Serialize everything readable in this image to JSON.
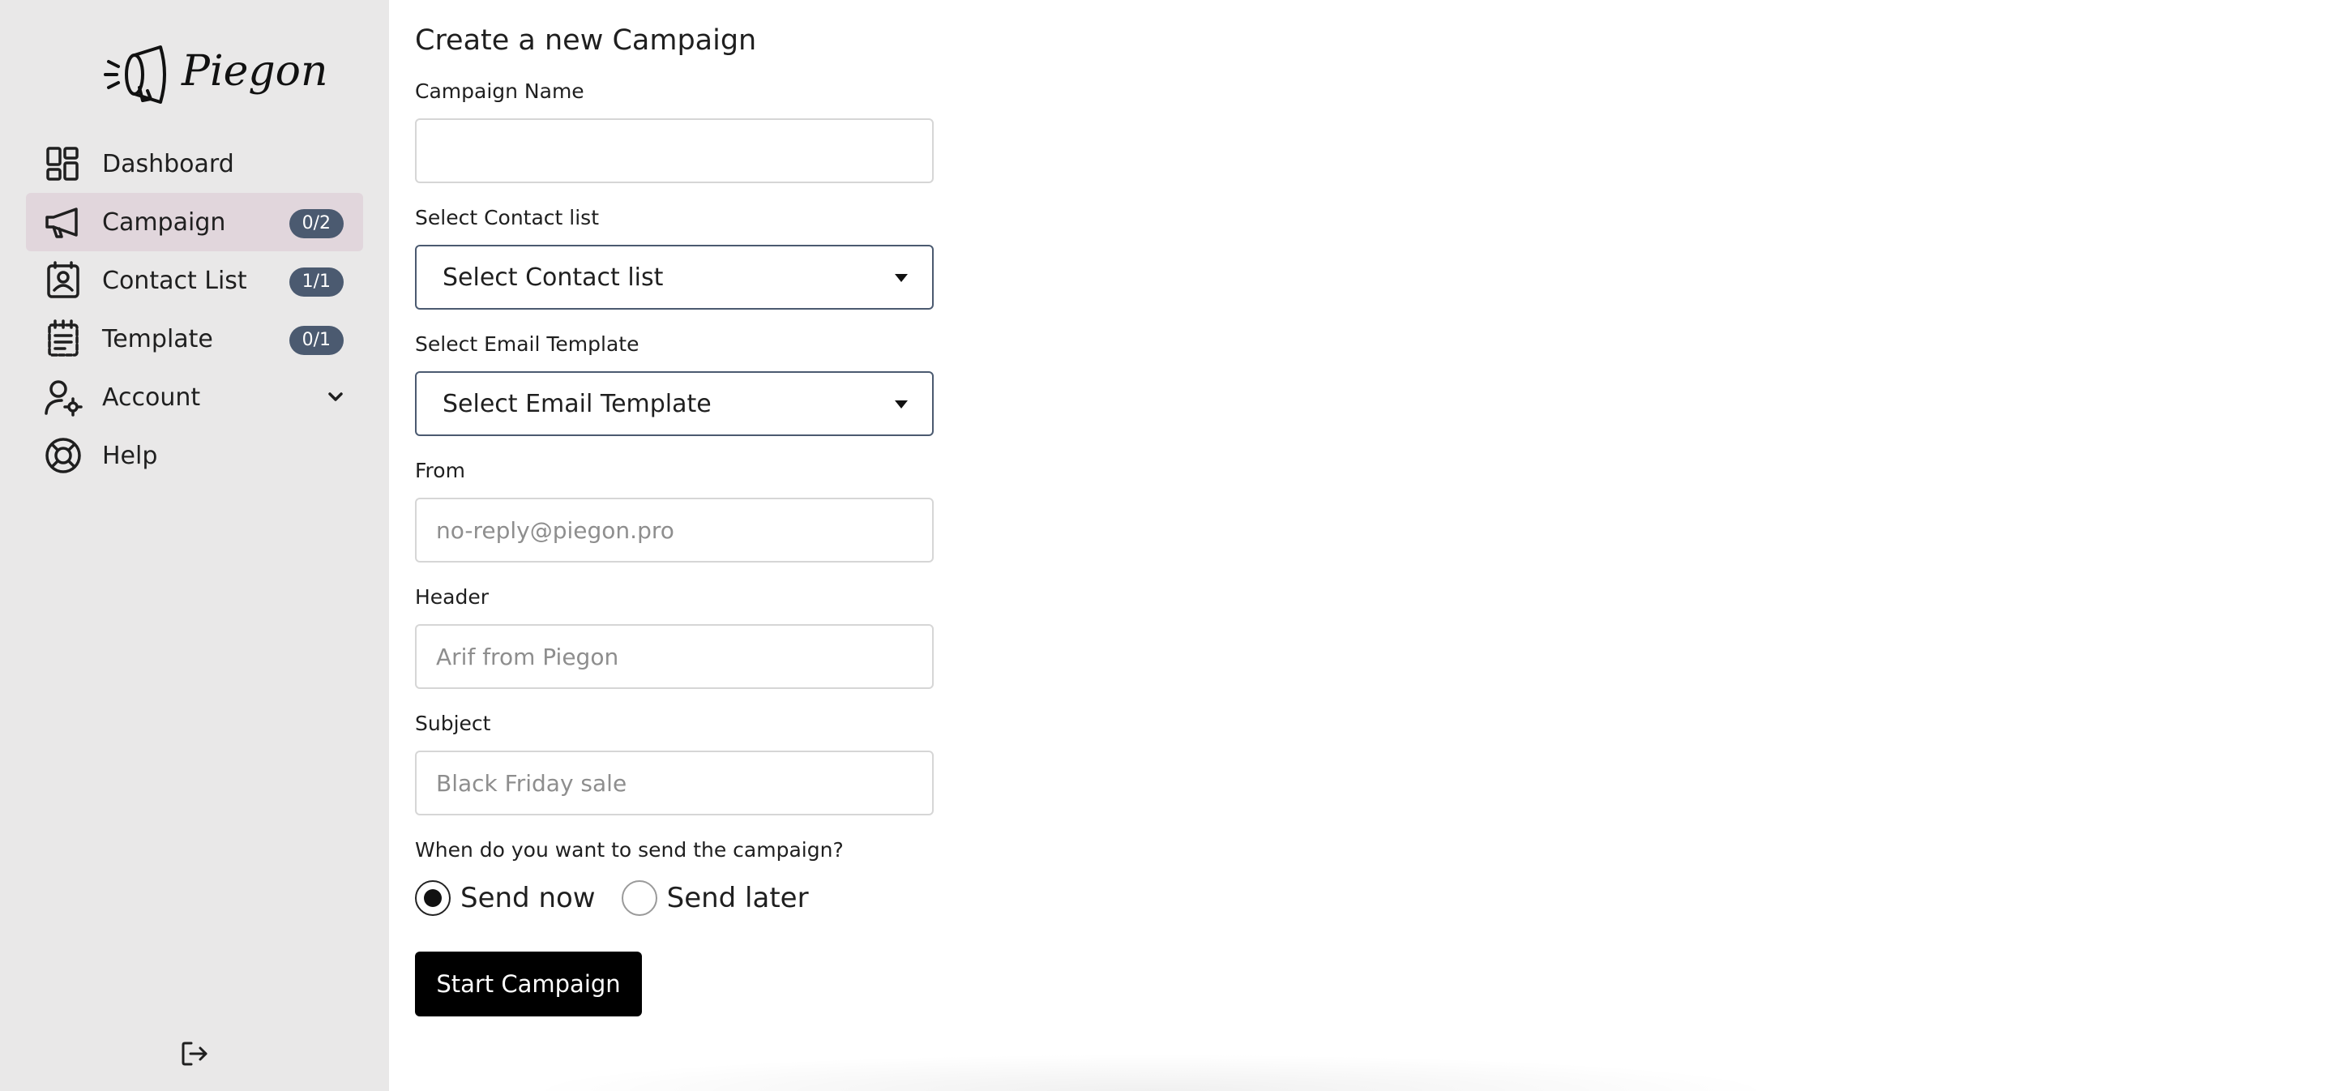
{
  "app": {
    "name": "Piegon"
  },
  "sidebar": {
    "items": [
      {
        "label": "Dashboard",
        "icon": "dashboard-icon"
      },
      {
        "label": "Campaign",
        "icon": "megaphone-icon",
        "badge": "0/2",
        "active": true
      },
      {
        "label": "Contact List",
        "icon": "contact-book-icon",
        "badge": "1/1"
      },
      {
        "label": "Template",
        "icon": "template-icon",
        "badge": "0/1"
      },
      {
        "label": "Account",
        "icon": "user-gear-icon"
      },
      {
        "label": "Help",
        "icon": "lifebuoy-icon"
      }
    ],
    "logout_icon": "logout-icon"
  },
  "form": {
    "title": "Create a new Campaign",
    "campaign_name": {
      "label": "Campaign Name",
      "value": "",
      "placeholder": ""
    },
    "contact_list": {
      "label": "Select Contact list",
      "selected": "Select Contact list"
    },
    "email_template": {
      "label": "Select Email Template",
      "selected": "Select Email Template"
    },
    "from": {
      "label": "From",
      "placeholder": "no-reply@piegon.pro"
    },
    "header": {
      "label": "Header",
      "placeholder": "Arif from Piegon"
    },
    "subject": {
      "label": "Subject",
      "placeholder": "Black Friday sale"
    },
    "schedule": {
      "question": "When do you want to send the campaign?",
      "options": [
        "Send now",
        "Send later"
      ],
      "selected": "Send now"
    },
    "submit_label": "Start Campaign"
  },
  "colors": {
    "sidebar_bg": "#e9e8e8",
    "active_item_bg": "#e1d6dc",
    "badge_bg": "#4b5a70",
    "button_bg": "#000000"
  }
}
